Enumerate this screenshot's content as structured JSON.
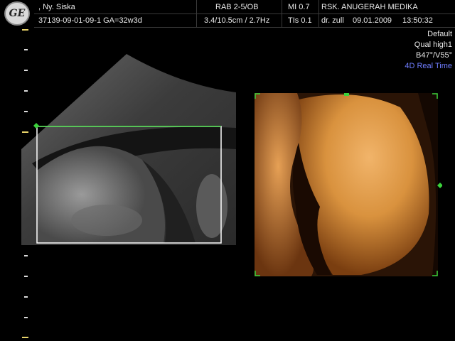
{
  "header": {
    "patient": ", Ny. Siska",
    "id_ga": "37139-09-01-09-1  GA=32w3d",
    "probe": "RAB 2-5/OB",
    "depth_freq": "3.4/10.5cm / 2.7Hz",
    "mi": "MI  0.7",
    "tis": "TIs  0.1",
    "hospital": "RSK. ANUGERAH MEDIKA",
    "doctor": "dr. zull",
    "date": "09.01.2009",
    "time": "13:50:32"
  },
  "logo": {
    "text": "GE",
    "icon": "ge-logo-icon"
  },
  "settings": {
    "preset": "Default",
    "quality": "Qual high1",
    "angles": "B47°/V55°",
    "mode": "4D Real Time"
  },
  "colors": {
    "mode_text": "#6f7dff",
    "roi_box": "#ffffff",
    "render_marker": "#3bd23b",
    "ruler_tick_highlight": "#e8d36a",
    "render_skin": "#d9923e"
  }
}
